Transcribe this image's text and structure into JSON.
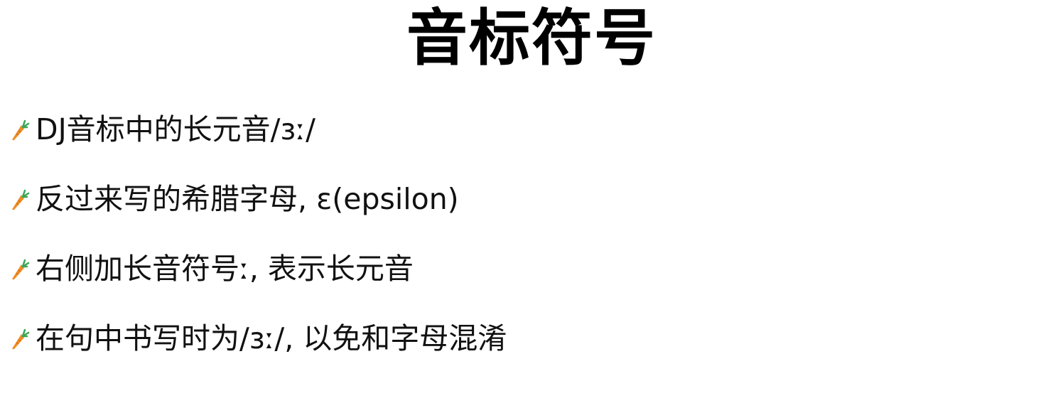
{
  "title": "音标符号",
  "bullet_icon": "carrot-icon",
  "bullets": [
    {
      "text": "DJ音标中的长元音/ɜː/"
    },
    {
      "text": "反过来写的希腊字母, ε(epsilon)"
    },
    {
      "text": "右侧加长音符号ː, 表示长元音"
    },
    {
      "text": "在句中书写时为/ɜː/, 以免和字母混淆"
    }
  ],
  "colors": {
    "carrot_body": "#f08a24",
    "carrot_leaves": "#3aa655",
    "text": "#111111"
  }
}
